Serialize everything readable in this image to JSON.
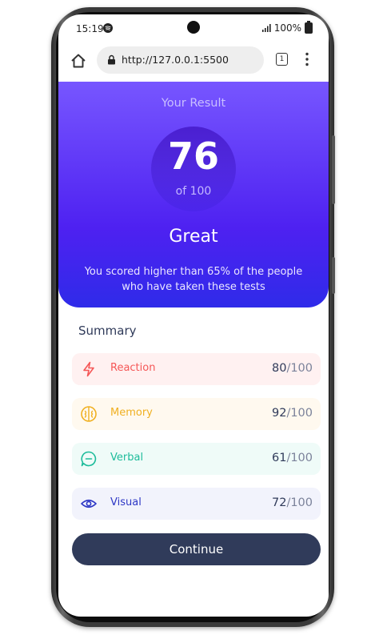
{
  "status": {
    "time": "15:19",
    "battery": "100%"
  },
  "browser": {
    "url": "http://127.0.0.1:5500",
    "tab_count": "1"
  },
  "result": {
    "title": "Your Result",
    "score": "76",
    "of_text": "of 100",
    "verdict": "Great",
    "description": "You scored higher than 65% of the people who have taken these tests"
  },
  "summary": {
    "title": "Summary",
    "items": [
      {
        "label": "Reaction",
        "score": "80",
        "max": "/100",
        "icon": "lightning-icon",
        "color": "#f55757",
        "bg": "#fff1f1"
      },
      {
        "label": "Memory",
        "score": "92",
        "max": "/100",
        "icon": "brain-icon",
        "color": "#f0b022",
        "bg": "#fff9ef"
      },
      {
        "label": "Verbal",
        "score": "61",
        "max": "/100",
        "icon": "chat-icon",
        "color": "#1ebc9b",
        "bg": "#effbf8"
      },
      {
        "label": "Visual",
        "score": "72",
        "max": "/100",
        "icon": "eye-icon",
        "color": "#2d37c5",
        "bg": "#f2f3fc"
      }
    ]
  },
  "continue_label": "Continue",
  "colors": {
    "hero_top": "#7756ff",
    "hero_bottom": "#2f2be9",
    "button": "#303b5a"
  }
}
